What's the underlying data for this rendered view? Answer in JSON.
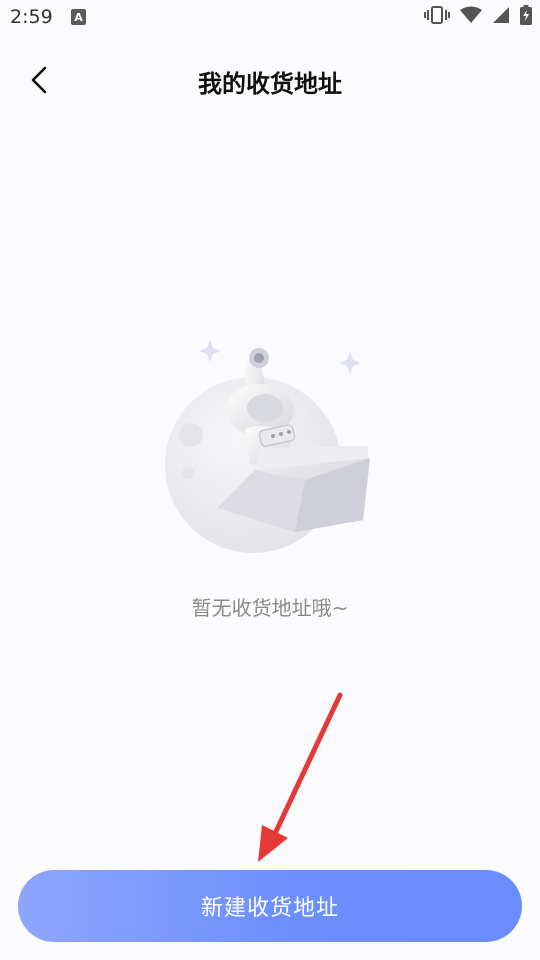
{
  "status_bar": {
    "time": "2:59",
    "notification_icon_letter": "A",
    "icons": [
      "vibrate-icon",
      "wifi-icon",
      "cellular-signal-icon",
      "battery-charging-icon"
    ]
  },
  "header": {
    "title": "我的收货地址",
    "back_icon": "chevron-left-icon"
  },
  "empty_state": {
    "illustration": "astronaut-moon-illustration",
    "message": "暂无收货地址哦~"
  },
  "actions": {
    "add_address_label": "新建收货地址"
  },
  "annotation": {
    "arrow_icon": "red-arrow-icon",
    "arrow_color": "#e53935"
  },
  "colors": {
    "background": "#fbfbfd",
    "button_gradient_start": "#8ea5fb",
    "button_gradient_end": "#6a8cff",
    "title_text": "#111111",
    "empty_text": "#8a8a8a"
  }
}
